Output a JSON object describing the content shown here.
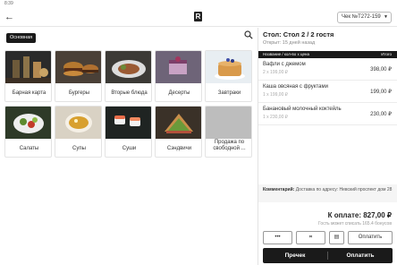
{
  "status": {
    "time": "8:39"
  },
  "appbar": {
    "logo": "R",
    "check": "Чек №T272-159"
  },
  "left": {
    "category": "Основная",
    "tiles": [
      {
        "label": "Барная карта",
        "icon": "bar-drinks-photo"
      },
      {
        "label": "Бургеры",
        "icon": "burger-photo"
      },
      {
        "label": "Вторые блюда",
        "icon": "main-dish-photo"
      },
      {
        "label": "Десерты",
        "icon": "dessert-photo"
      },
      {
        "label": "Завтраки",
        "icon": "pancakes-photo"
      },
      {
        "label": "Салаты",
        "icon": "salad-photo"
      },
      {
        "label": "Супы",
        "icon": "soup-photo"
      },
      {
        "label": "Суши",
        "icon": "sushi-photo"
      },
      {
        "label": "Сэндвичи",
        "icon": "sandwich-photo"
      },
      {
        "label": "Продажа по свободной ...",
        "icon": "empty-placeholder"
      }
    ]
  },
  "order": {
    "title": "Стол: Стол 2 / 2 гостя",
    "opened": "Открыт: 15 дней назад",
    "col_name": "Название / кол-во х цена",
    "col_total": "Итого",
    "items": [
      {
        "name": "Вафли с джемом",
        "qty": "2 x 199,00 ₽",
        "sum": "398,00 ₽"
      },
      {
        "name": "Каша овсяная с фруктами",
        "qty": "1 x 199,00 ₽",
        "sum": "199,00 ₽"
      },
      {
        "name": "Банановый молочный коктейль",
        "qty": "1 x 230,00 ₽",
        "sum": "230,00 ₽"
      }
    ],
    "comment_label": "Комментарий:",
    "comment_text": "Доставка по адресу: Невский проспект дом 28",
    "total": "К оплате: 827,00 ₽",
    "bonus": "Гость может списать 165.4 бонусов",
    "btn_more": "•••",
    "btn_scan": "⌗",
    "btn_print": "▤",
    "btn_split": "Оплатить",
    "btn_receipt": "Пречек",
    "btn_pay": "Оплатить"
  },
  "colors": {
    "dark": "#1a1a1a",
    "border": "#e3e3e3",
    "muted": "#aaaaaa"
  }
}
